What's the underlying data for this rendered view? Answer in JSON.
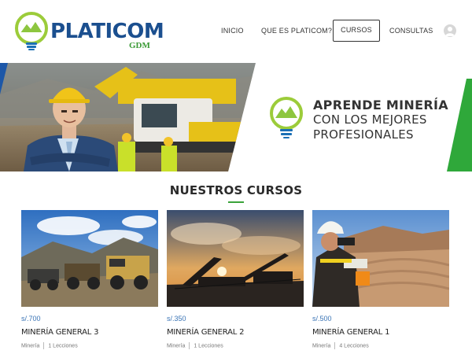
{
  "brand": {
    "name": "PLATICOM",
    "sub": "GDM",
    "colors": {
      "blue": "#1b4f8f",
      "green": "#3a9a35"
    }
  },
  "nav": {
    "items": [
      {
        "label": "INICIO"
      },
      {
        "label": "QUE ES PLATICOM?"
      },
      {
        "label": "CURSOS",
        "active": true
      },
      {
        "label": "CONSULTAS"
      }
    ]
  },
  "hero": {
    "line1": "APRENDE MINERÍA",
    "line2": "CON LOS MEJORES",
    "line3": "PROFESIONALES"
  },
  "section": {
    "title": "NUESTROS CURSOS"
  },
  "courses": [
    {
      "price": "s/.700",
      "title": "MINERÍA GENERAL 3",
      "category": "Minería",
      "lessons": "1 Lecciones"
    },
    {
      "price": "s/.350",
      "title": "MINERÍA GENERAL 2",
      "category": "Minería",
      "lessons": "1 Lecciones"
    },
    {
      "price": "s/.500",
      "title": "MINERÍA GENERAL 1",
      "category": "Minería",
      "lessons": "4 Lecciones"
    }
  ]
}
